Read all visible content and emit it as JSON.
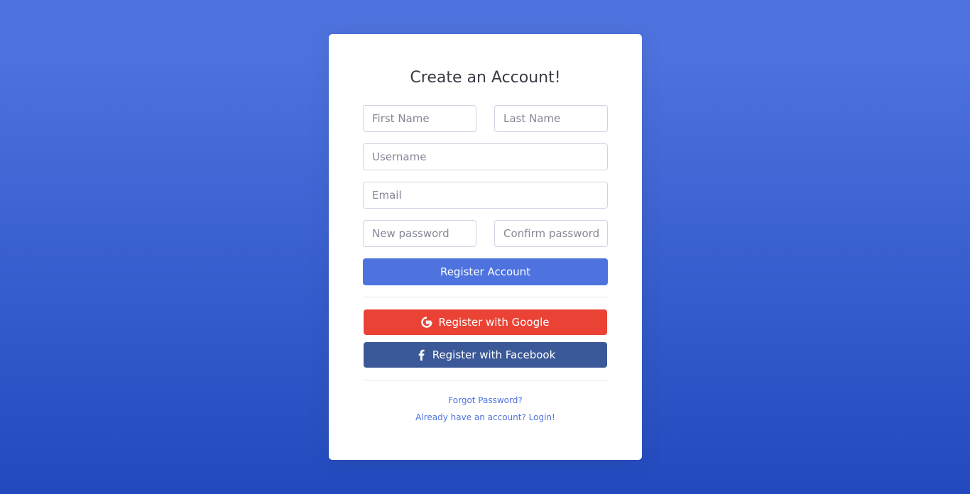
{
  "title": "Create an Account!",
  "fields": {
    "first_name": {
      "placeholder": "First Name",
      "value": ""
    },
    "last_name": {
      "placeholder": "Last Name",
      "value": ""
    },
    "username": {
      "placeholder": "Username",
      "value": ""
    },
    "email": {
      "placeholder": "Email",
      "value": ""
    },
    "new_password": {
      "placeholder": "New password",
      "value": ""
    },
    "confirm_password": {
      "placeholder": "Confirm password",
      "value": ""
    }
  },
  "buttons": {
    "register": "Register Account",
    "google": "Register with Google",
    "facebook": "Register with Facebook"
  },
  "icons": {
    "google": "google-icon",
    "facebook": "facebook-icon"
  },
  "links": {
    "forgot": "Forgot Password?",
    "login": "Already have an account? Login!"
  },
  "colors": {
    "primary": "#4e73df",
    "google": "#ea4335",
    "facebook": "#3b5998",
    "background_top": "#4e73df",
    "background_bottom": "#224abe"
  }
}
